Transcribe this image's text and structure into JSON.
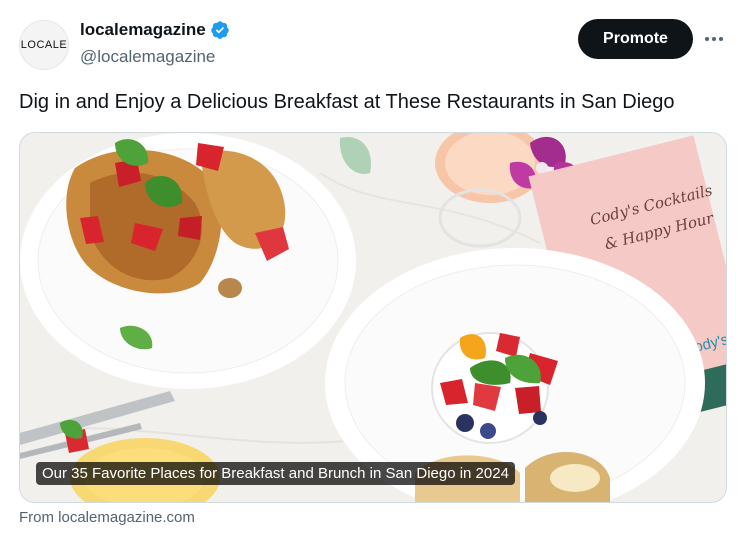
{
  "account": {
    "avatar_text": "LOCALE",
    "display_name": "localemagazine",
    "handle": "@localemagazine",
    "verified_icon": "verified-badge-icon",
    "verified_color": "#1d9bf0"
  },
  "actions": {
    "promote_label": "Promote",
    "more_icon": "more-dots-icon"
  },
  "tweet": {
    "text": "Dig in and Enjoy a Delicious Breakfast at These Restaurants in San Diego"
  },
  "card": {
    "caption": "Our 35 Favorite Places for Breakfast and Brunch in San Diego in 2024",
    "menu_script_line1": "Cody's Cocktails",
    "menu_script_line2": "& Happy Hour",
    "menu_brand": "cody's",
    "source": "From localemagazine.com"
  },
  "colors": {
    "text_primary": "#0f1419",
    "text_secondary": "#536471",
    "button_bg": "#0f1419",
    "border": "#cfd9de"
  }
}
